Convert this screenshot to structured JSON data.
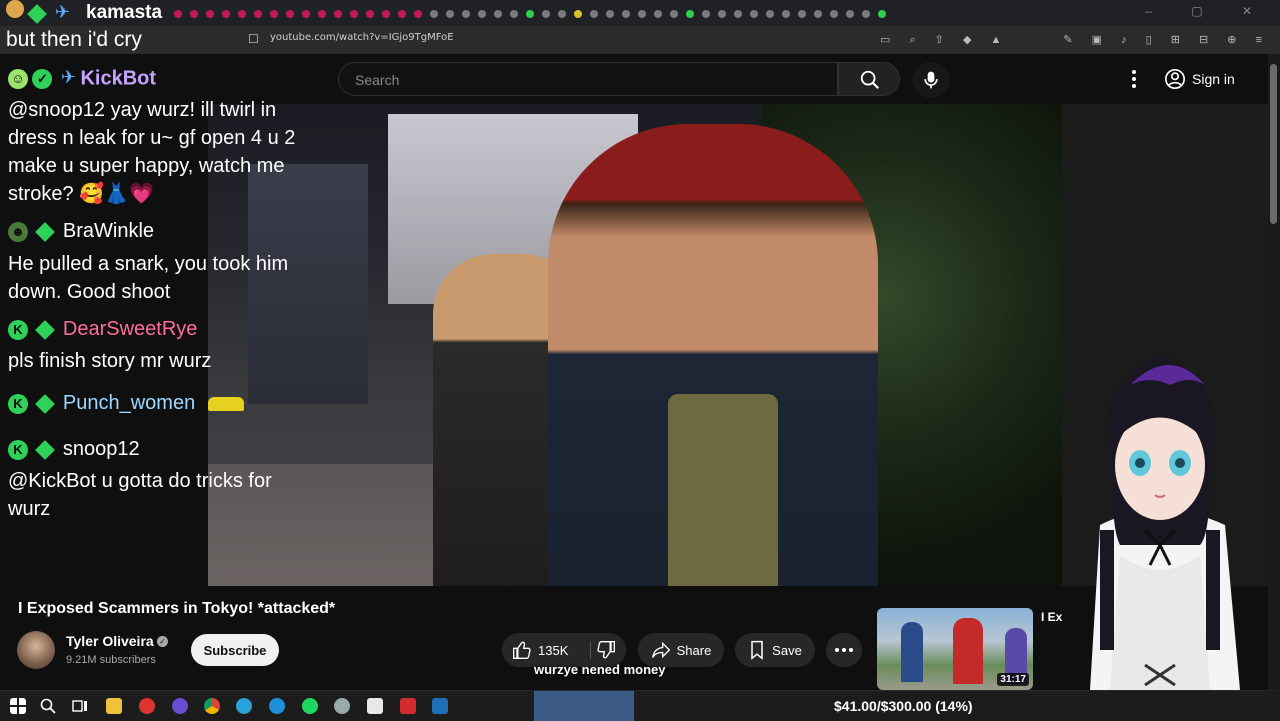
{
  "browser": {
    "tab_title": "kamasta",
    "url": "youtube.com/watch?v=IGjo9TgMFoE"
  },
  "header": {
    "search_placeholder": "Search",
    "signin_label": "Sign in"
  },
  "chat": {
    "top_line": "but then i'd cry",
    "messages": [
      {
        "user": "KickBot",
        "user_color": "#c8a2ff",
        "text": "@snoop12 yay wurz! ill twirl in dress n leak for u~ gf open 4 u 2 make u super happy, watch me stroke? 🥰👗💗"
      },
      {
        "user": "BraWinkle",
        "user_color": "#ffffff",
        "text": "He pulled a snark, you took him down. Good shoot"
      },
      {
        "user": "DearSweetRye",
        "user_color": "#ff6e9a",
        "text": "pls finish story mr wurz"
      },
      {
        "user": "Punch_women",
        "user_color": "#9ed8ff",
        "text": ""
      },
      {
        "user": "snoop12",
        "user_color": "#ffffff",
        "text": "@KickBot u gotta do tricks for wurz"
      }
    ]
  },
  "video": {
    "title": "I Exposed Scammers in Tokyo! *attacked*",
    "channel": "Tyler Oliveira",
    "subscribers": "9.21M subscribers",
    "subscribe_label": "Subscribe",
    "likes": "135K",
    "share_label": "Share",
    "save_label": "Save",
    "caption": "wurzye nened money"
  },
  "recommendation": {
    "title_fragment": "I Ex",
    "duration": "31:17"
  },
  "taskbar": {
    "donation_goal": "$41.00/$300.00 (14%)"
  }
}
